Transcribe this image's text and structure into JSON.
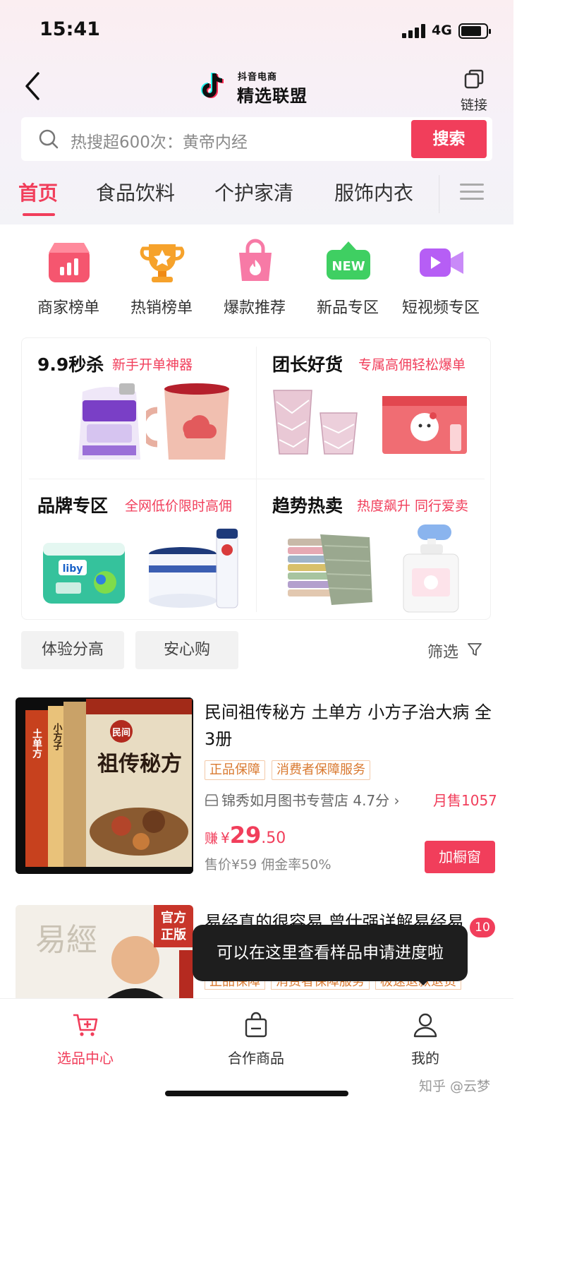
{
  "status_bar": {
    "time": "15:41",
    "network": "4G"
  },
  "header": {
    "brand_small": "抖音电商",
    "brand_big": "精选联盟",
    "link_label": "链接"
  },
  "search": {
    "placeholder": "热搜超600次：黄帝内经",
    "button": "搜索"
  },
  "tabs": [
    "首页",
    "食品饮料",
    "个护家清",
    "服饰内衣"
  ],
  "categories": [
    {
      "label": "商家榜单",
      "icon": "shop-ranking-icon",
      "color": "#f5566f"
    },
    {
      "label": "热销榜单",
      "icon": "trophy-icon",
      "color": "#f6a22b"
    },
    {
      "label": "爆款推荐",
      "icon": "hot-bag-icon",
      "color": "#f77aa6"
    },
    {
      "label": "新品专区",
      "icon": "new-tag-icon",
      "color": "#3fcf62"
    },
    {
      "label": "短视频专区",
      "icon": "video-camera-icon",
      "color": "#b65ef5"
    }
  ],
  "promos": [
    {
      "title": "9.9秒杀",
      "subtitle": "新手开单神器"
    },
    {
      "title": "团长好货",
      "subtitle": "专属高佣轻松爆单"
    },
    {
      "title": "品牌专区",
      "subtitle": "全网低价限时高佣"
    },
    {
      "title": "趋势热卖",
      "subtitle": "热度飙升 同行爱卖"
    }
  ],
  "filters": {
    "chips": [
      "体验分高",
      "安心购"
    ],
    "filter_label": "筛选"
  },
  "products": [
    {
      "title": "民间祖传秘方 土单方 小方子治大病 全3册",
      "tags": [
        "正品保障",
        "消费者保障服务"
      ],
      "shop": "锦秀如月图书专营店 4.7分",
      "sales": "月售1057",
      "earn_label": "赚",
      "currency": "¥",
      "price_int": "29",
      "price_dec": ".50",
      "price_info": "售价¥59   佣金率50%",
      "button": "加橱窗",
      "cover_text": [
        "民间",
        "祖传秘方",
        "小方子",
        "土单方"
      ]
    },
    {
      "title": "易经真的很容易 曾仕强详解易经易",
      "tags": [
        "正品保障",
        "消费者保障服务",
        "极速退款退货"
      ],
      "cover_text": [
        "易經",
        "官方",
        "正版"
      ]
    }
  ],
  "tooltip": {
    "text": "可以在这里查看样品申请进度啦",
    "badge": "10"
  },
  "bottom_nav": [
    {
      "label": "选品中心",
      "active": true
    },
    {
      "label": "合作商品",
      "active": false
    },
    {
      "label": "我的",
      "active": false
    }
  ],
  "watermark": "知乎 @云梦",
  "colors": {
    "accent": "#f13e5b",
    "tag": "#d9782e"
  }
}
